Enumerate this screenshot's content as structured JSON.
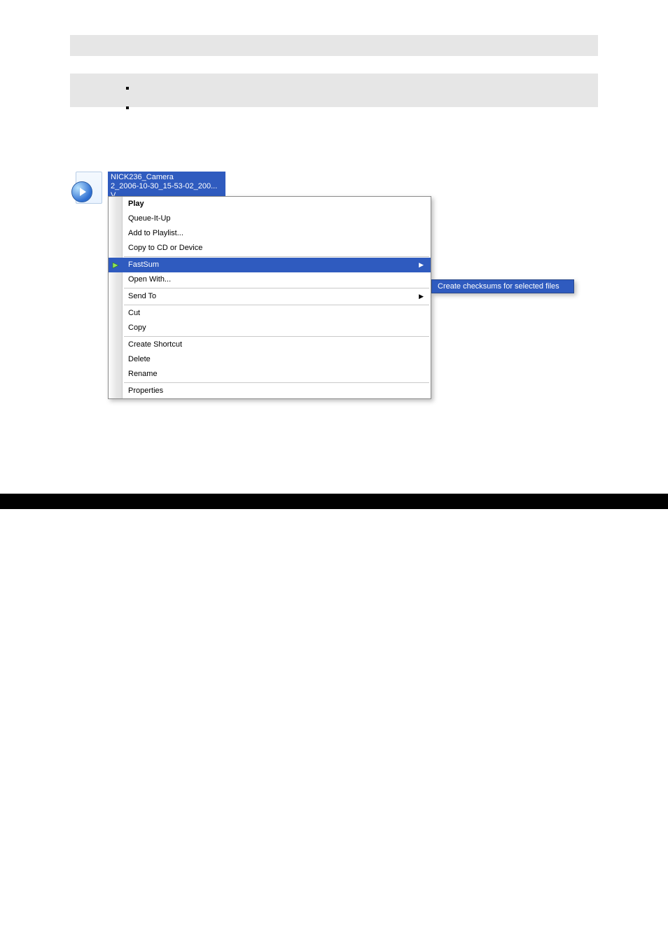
{
  "header": {
    "title": ""
  },
  "bullets_top": [
    {
      "text": ""
    },
    {
      "text": ""
    }
  ],
  "bullets_bottom": [
    {
      "text": ""
    },
    {
      "text": ""
    },
    {
      "text": ""
    },
    {
      "text": ""
    }
  ],
  "body": {
    "p1": "",
    "p2": "",
    "link_text": "                                     ",
    "p3": "",
    "p4": ""
  },
  "figure": {
    "file_label_line1": "NICK236_Camera",
    "file_label_line2": "2_2006-10-30_15-53-02_200...",
    "file_label_line3": "V",
    "menu": {
      "play": "Play",
      "queue": "Queue-It-Up",
      "add_playlist": "Add to Playlist...",
      "copy_cd": "Copy to CD or Device",
      "fastsum": "FastSum",
      "open_with": "Open With...",
      "send_to": "Send To",
      "cut": "Cut",
      "copy": "Copy",
      "create_shortcut": "Create Shortcut",
      "delete": "Delete",
      "rename": "Rename",
      "properties": "Properties"
    },
    "submenu_item": "Create checksums for selected files"
  },
  "footer": {
    "text": ""
  }
}
